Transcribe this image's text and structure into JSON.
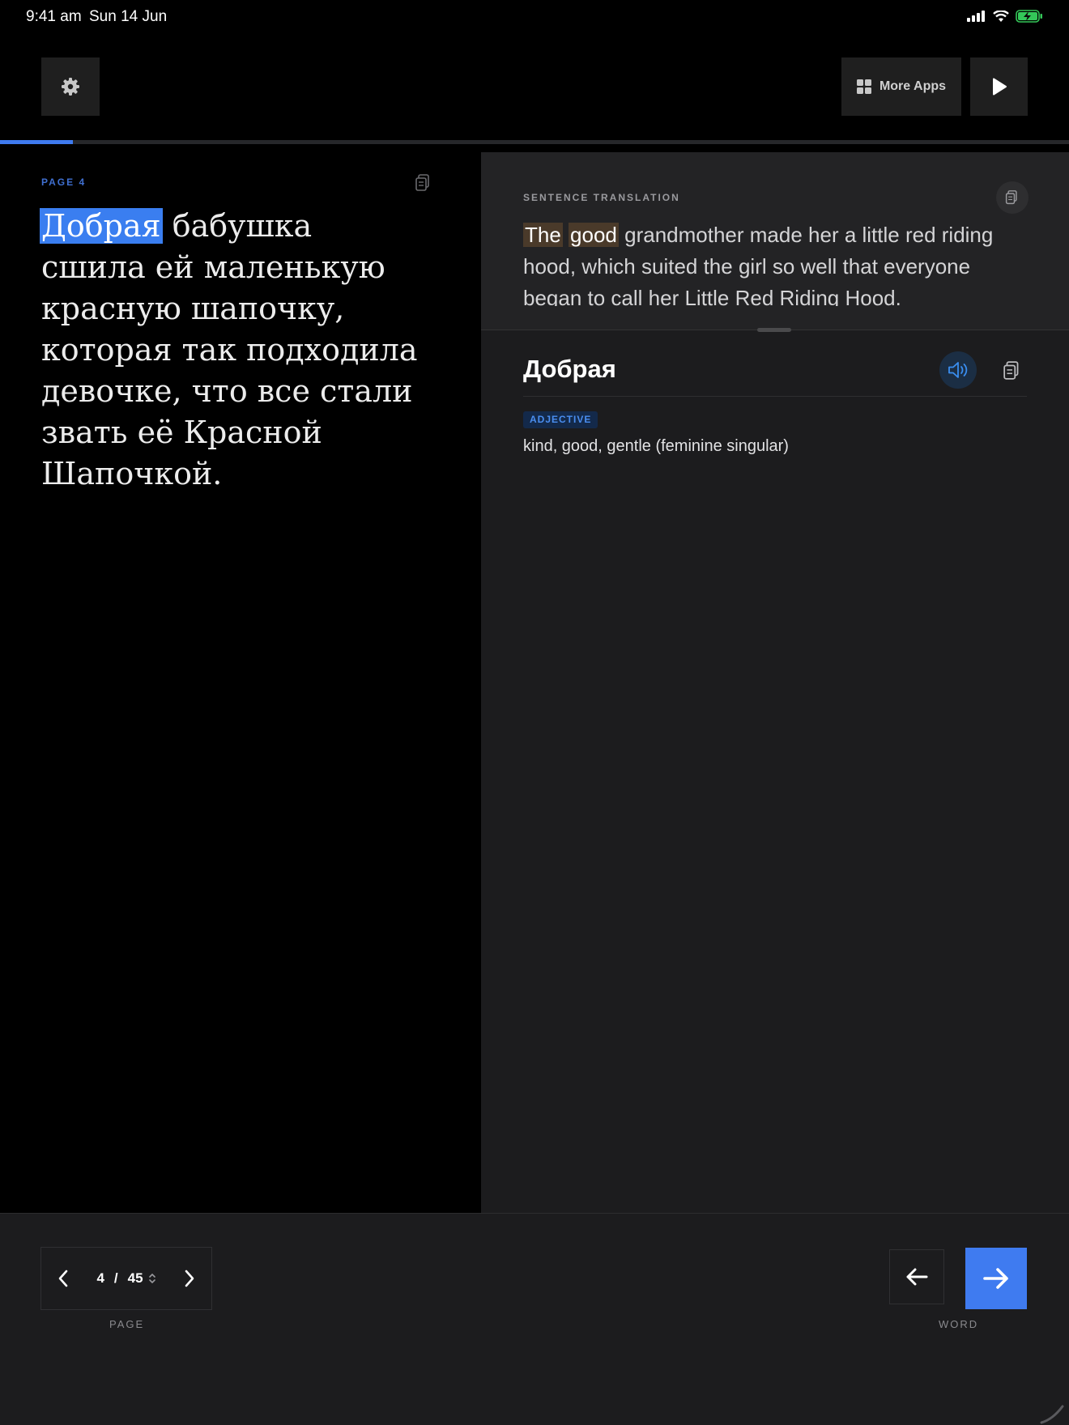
{
  "status_bar": {
    "time": "9:41 am",
    "date": "Sun 14 Jun"
  },
  "toolbar": {
    "settings_icon": "gear-icon",
    "more_apps_label": "More Apps",
    "more_apps_icon": "grid-icon",
    "play_icon": "play-icon"
  },
  "reading_progress": 0.068,
  "reader": {
    "page_label": "PAGE 4",
    "highlighted_word": "Добрая",
    "text_rest": " бабушка сшила ей маленькую красную шапочку, которая так подходила девочке, что все стали звать её Красной Шапочкой."
  },
  "translation": {
    "label": "SENTENCE TRANSLATION",
    "hl_1": "The",
    "hl_2": "good",
    "text_rest": " grandmother made her a little red riding hood, which suited the girl so well that everyone began to call her Little Red Riding Hood."
  },
  "word_detail": {
    "word": "Добрая",
    "part_of_speech": "ADJECTIVE",
    "definition": "kind, good, gentle (feminine singular)"
  },
  "bottom": {
    "current_page": "4",
    "separator": "/",
    "total_pages": "45",
    "page_label": "PAGE",
    "word_label": "WORD"
  },
  "colors": {
    "accent": "#3f7bf0",
    "word_highlight": "#3a7ef0",
    "translation_highlight": "#4a3a2a"
  }
}
